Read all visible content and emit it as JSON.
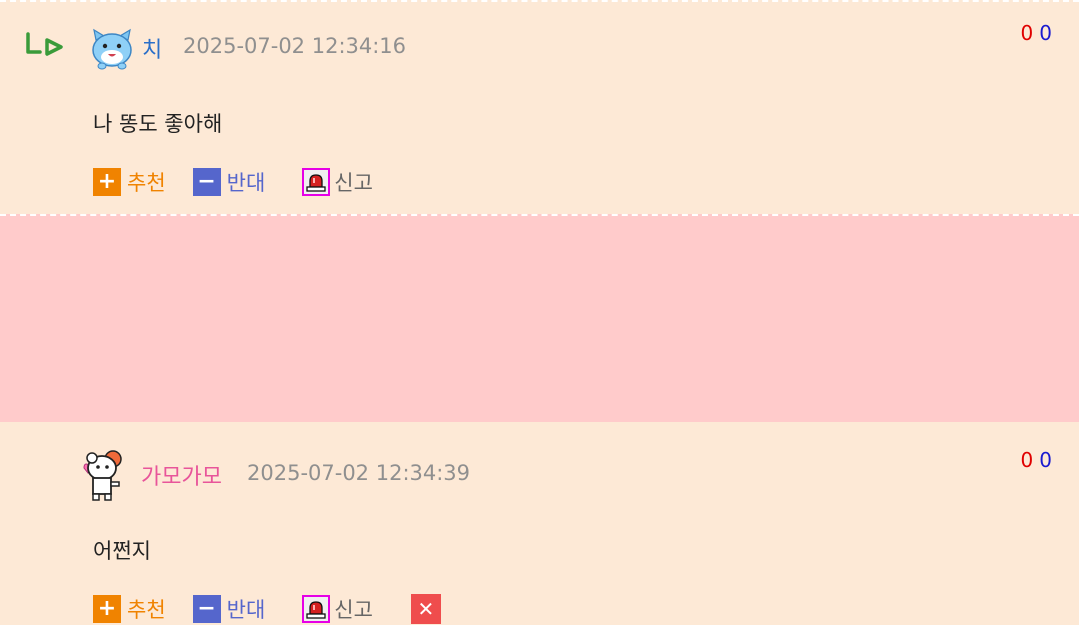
{
  "comments": [
    {
      "nickname": "치",
      "timestamp": "2025-07-02 12:34:16",
      "content": "나 똥도 좋아해",
      "votes_up": "0",
      "votes_down": "0",
      "is_reply": true
    },
    {
      "nickname": "가모가모",
      "timestamp": "2025-07-02 12:34:39",
      "content": "어쩐지",
      "votes_up": "0",
      "votes_down": "0",
      "is_reply": false
    }
  ],
  "actions": {
    "recommend_label": "추천",
    "oppose_label": "반대",
    "report_label": "신고"
  },
  "icons": {
    "reply": "reply-arrow-icon",
    "recommend": "plus-icon",
    "oppose": "minus-icon",
    "report": "siren-icon",
    "delete": "close-icon"
  },
  "colors": {
    "comment1_bg": "#fde9d6",
    "comment2_bg": "#ffcbcb",
    "nickname1": "#2a6fc9",
    "nickname2": "#e8559a",
    "recommend": "#f08300",
    "oppose": "#5566cc",
    "report": "#e600e6",
    "delete": "#ef4d4d",
    "vote_up": "#e00000",
    "vote_down": "#1a1ad0"
  }
}
